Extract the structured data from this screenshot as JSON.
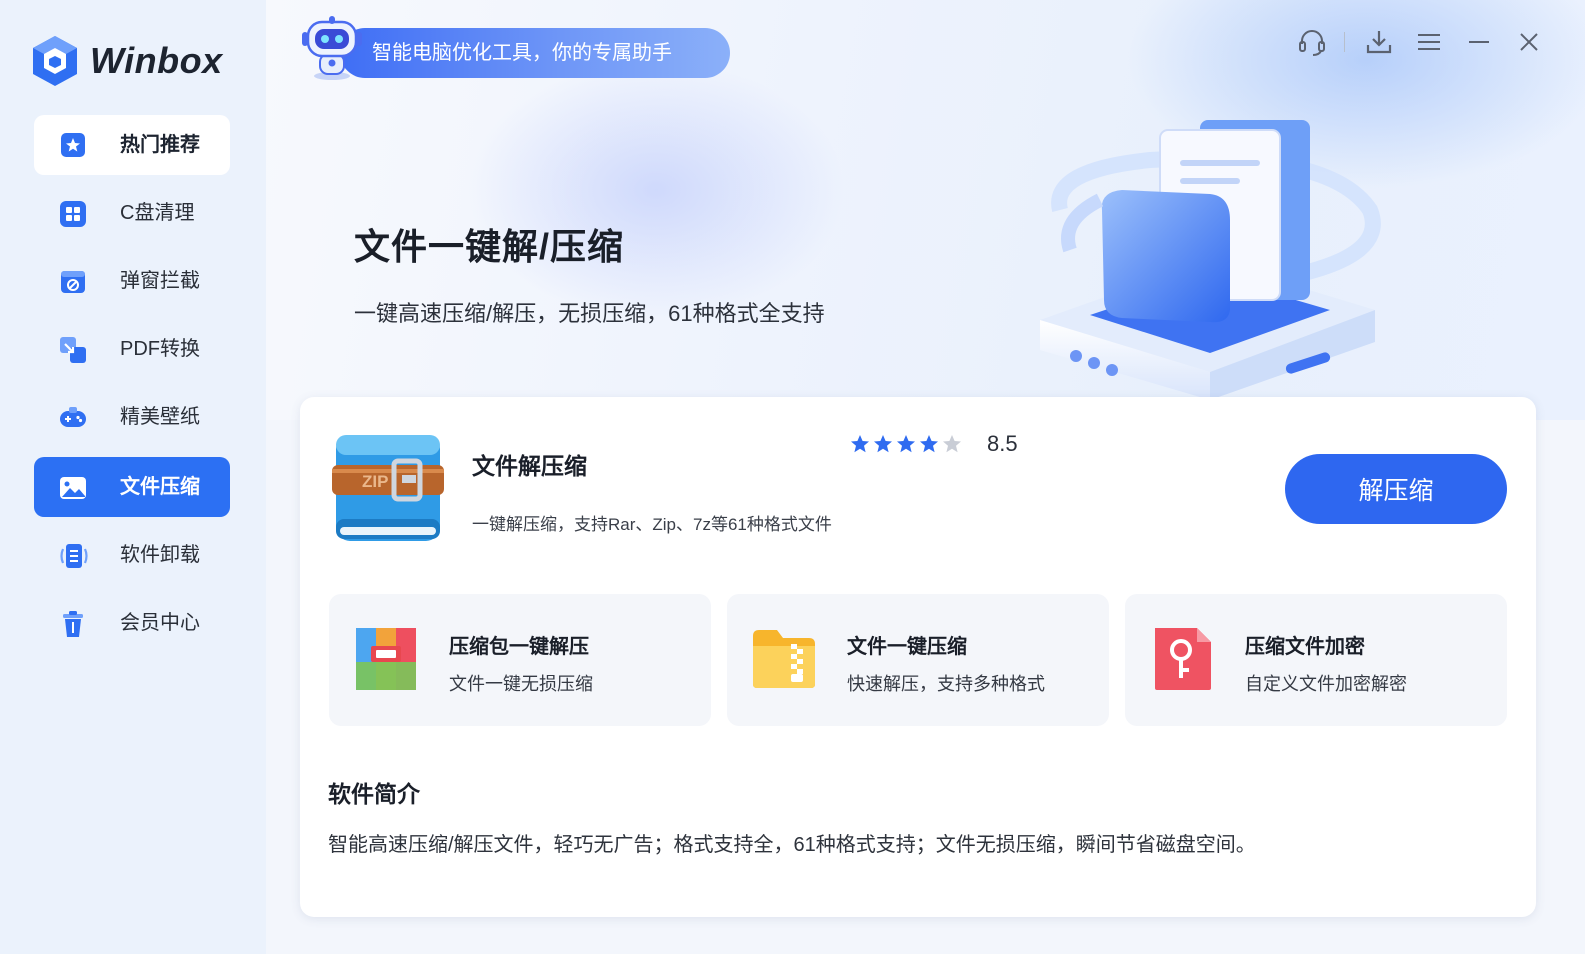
{
  "app": {
    "name": "Winbox"
  },
  "sidebar": {
    "items": [
      {
        "label": "热门推荐",
        "icon": "star-badge-icon",
        "state": "highlighted"
      },
      {
        "label": "C盘清理",
        "icon": "grid-icon",
        "state": "normal"
      },
      {
        "label": "弹窗拦截",
        "icon": "popup-block-icon",
        "state": "normal"
      },
      {
        "label": "PDF转换",
        "icon": "convert-icon",
        "state": "normal"
      },
      {
        "label": "精美壁纸",
        "icon": "gamepad-icon",
        "state": "normal"
      },
      {
        "label": "文件压缩",
        "icon": "image-icon",
        "state": "active"
      },
      {
        "label": "软件卸载",
        "icon": "uninstall-icon",
        "state": "normal"
      },
      {
        "label": "会员中心",
        "icon": "trash-icon",
        "state": "normal"
      }
    ]
  },
  "header": {
    "slogan": "智能电脑优化工具，你的专属助手",
    "controls": [
      "headset-icon",
      "download-icon",
      "menu-icon",
      "minimize-icon",
      "close-icon"
    ]
  },
  "hero": {
    "title": "文件一键解/压缩",
    "subtitle": "一键高速压缩/解压，无损压缩，61种格式全支持"
  },
  "product": {
    "name": "文件解压缩",
    "description": "一键解压缩，支持Rar、Zip、7z等61种格式文件",
    "rating_score": "8.5",
    "stars_filled": 4,
    "stars_total": 5,
    "action_label": "解压缩"
  },
  "features": [
    {
      "title": "压缩包一键解压",
      "desc": "文件一键无损压缩",
      "icon": "archive-box-icon"
    },
    {
      "title": "文件一键压缩",
      "desc": "快速解压，支持多种格式",
      "icon": "zip-folder-icon"
    },
    {
      "title": "压缩文件加密",
      "desc": "自定义文件加密解密",
      "icon": "key-file-icon"
    }
  ],
  "intro": {
    "title": "软件简介",
    "text": "智能高速压缩/解压文件，轻巧无广告；格式支持全，61种格式支持；文件无损压缩，瞬间节省磁盘空间。"
  },
  "colors": {
    "accent": "#2c70f3",
    "sidebar_bg": "#ebf2fc",
    "star": "#2f6bf0",
    "star_empty": "#c9cdd6"
  }
}
